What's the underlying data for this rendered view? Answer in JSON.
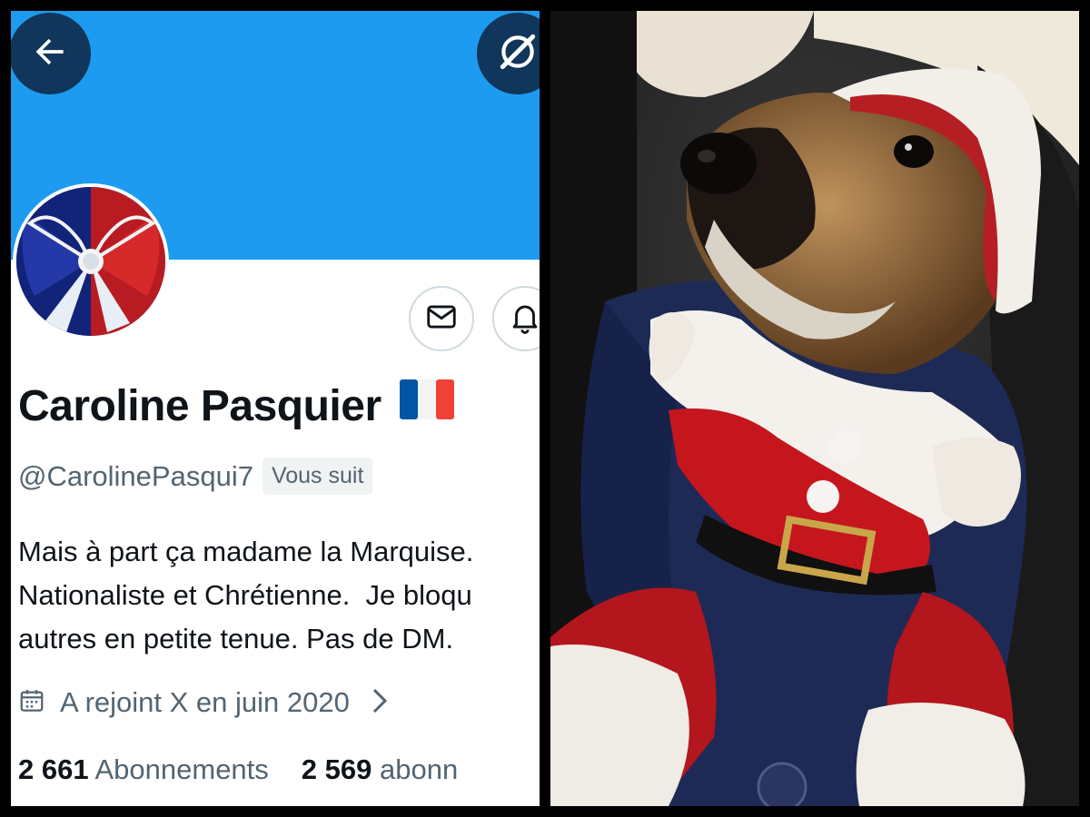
{
  "profile": {
    "display_name": "Caroline Pasquier",
    "flag_emoji": "🇫🇷",
    "handle": "@CarolinePasqui7",
    "follows_you_badge": "Vous suit",
    "bio_lines": [
      "Mais à part ça madame la Marquise.",
      "Nationaliste et Chrétienne.  Je bloqu",
      "autres en petite tenue. Pas de DM."
    ],
    "joined": "A rejoint X en juin 2020",
    "following": {
      "count": "2 661",
      "label": "Abonnements"
    },
    "followers": {
      "count": "2 569",
      "label": "abonn"
    }
  },
  "icons": {
    "back": "arrow-left-icon",
    "grok": "grok-icon",
    "message": "envelope-icon",
    "notifications": "bell-icon",
    "calendar": "calendar-icon",
    "chevron": "chevron-right-icon"
  },
  "colors": {
    "banner": "#1d9bf0",
    "text_primary": "#0f1419",
    "text_secondary": "#536471",
    "badge_bg": "#eff3f4",
    "flag_blue": "#0055a4",
    "flag_red": "#ef4135"
  },
  "photo": {
    "subject": "dog-in-santa-costume"
  }
}
